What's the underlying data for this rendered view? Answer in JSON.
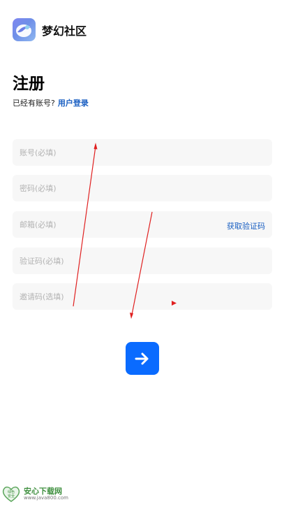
{
  "header": {
    "app_name": "梦幻社区",
    "logo_icon": "community-logo-icon"
  },
  "page": {
    "title": "注册",
    "have_account_text": "已经有账号?",
    "login_link": "用户登录"
  },
  "form": {
    "account_placeholder": "账号(必填)",
    "password_placeholder": "密码(必填)",
    "email_placeholder": "邮箱(必填)",
    "get_code_label": "获取验证码",
    "code_placeholder": "验证码(必填)",
    "invite_placeholder": "邀请码(选填)",
    "submit_icon": "arrow-right-icon"
  },
  "watermark": {
    "title": "安心下载网",
    "url": "www.java800.com",
    "badge_top": "绿色",
    "badge_bottom": "安全"
  },
  "colors": {
    "accent": "#0a6bff",
    "link": "#1a5fc2",
    "field_bg": "#f7f7f7",
    "annotation": "#e02020"
  }
}
